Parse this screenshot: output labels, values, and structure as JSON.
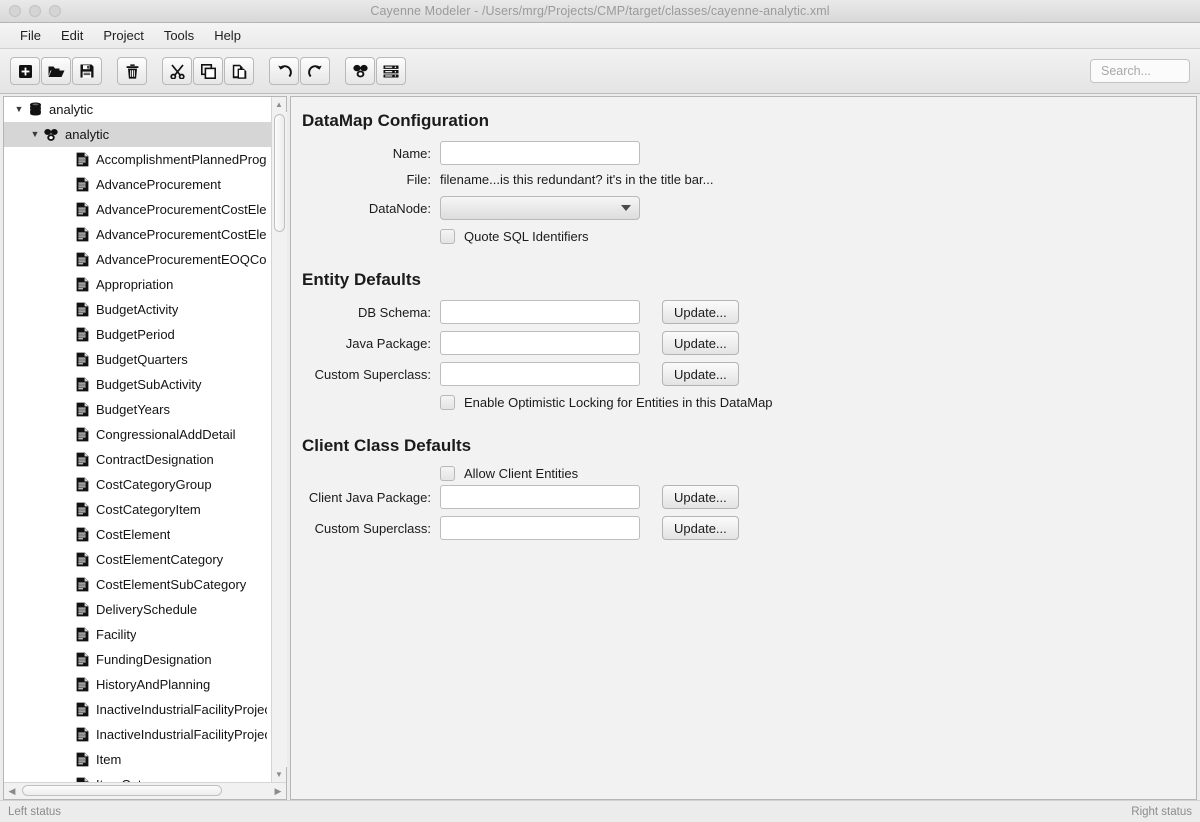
{
  "window": {
    "title": "Cayenne Modeler - /Users/mrg/Projects/CMP/target/classes/cayenne-analytic.xml"
  },
  "menubar": {
    "items": [
      {
        "label": "File"
      },
      {
        "label": "Edit"
      },
      {
        "label": "Project"
      },
      {
        "label": "Tools"
      },
      {
        "label": "Help"
      }
    ]
  },
  "toolbar": {
    "groups": [
      [
        {
          "icon": "new-project-icon",
          "name": "new-button"
        },
        {
          "icon": "open-folder-icon",
          "name": "open-button"
        },
        {
          "icon": "save-floppy-icon",
          "name": "save-button"
        }
      ],
      [
        {
          "icon": "trash-icon",
          "name": "delete-button"
        }
      ],
      [
        {
          "icon": "scissors-icon",
          "name": "cut-button"
        },
        {
          "icon": "copy-icon",
          "name": "copy-button"
        },
        {
          "icon": "paste-icon",
          "name": "paste-button"
        }
      ],
      [
        {
          "icon": "undo-arrow-icon",
          "name": "undo-button"
        },
        {
          "icon": "redo-arrow-icon",
          "name": "redo-button"
        }
      ],
      [
        {
          "icon": "datamap-cubes-icon",
          "name": "create-datamap-button"
        },
        {
          "icon": "datanode-stack-icon",
          "name": "create-datanode-button"
        }
      ]
    ],
    "search_placeholder": "Search...",
    "search_value": ""
  },
  "tree": {
    "nodes": [
      {
        "label": "analytic",
        "level": 0,
        "icon": "database-icon",
        "twisty": "down",
        "selected": false
      },
      {
        "label": "analytic",
        "level": 1,
        "icon": "datamap-icon",
        "twisty": "down",
        "selected": true
      },
      {
        "label": "AccomplishmentPlannedProgram",
        "level": 2,
        "icon": "entity-icon",
        "twisty": "",
        "selected": false
      },
      {
        "label": "AdvanceProcurement",
        "level": 2,
        "icon": "entity-icon",
        "twisty": "",
        "selected": false
      },
      {
        "label": "AdvanceProcurementCostElement",
        "level": 2,
        "icon": "entity-icon",
        "twisty": "",
        "selected": false
      },
      {
        "label": "AdvanceProcurementCostElementDetail",
        "level": 2,
        "icon": "entity-icon",
        "twisty": "",
        "selected": false
      },
      {
        "label": "AdvanceProcurementEOQCost",
        "level": 2,
        "icon": "entity-icon",
        "twisty": "",
        "selected": false
      },
      {
        "label": "Appropriation",
        "level": 2,
        "icon": "entity-icon",
        "twisty": "",
        "selected": false
      },
      {
        "label": "BudgetActivity",
        "level": 2,
        "icon": "entity-icon",
        "twisty": "",
        "selected": false
      },
      {
        "label": "BudgetPeriod",
        "level": 2,
        "icon": "entity-icon",
        "twisty": "",
        "selected": false
      },
      {
        "label": "BudgetQuarters",
        "level": 2,
        "icon": "entity-icon",
        "twisty": "",
        "selected": false
      },
      {
        "label": "BudgetSubActivity",
        "level": 2,
        "icon": "entity-icon",
        "twisty": "",
        "selected": false
      },
      {
        "label": "BudgetYears",
        "level": 2,
        "icon": "entity-icon",
        "twisty": "",
        "selected": false
      },
      {
        "label": "CongressionalAddDetail",
        "level": 2,
        "icon": "entity-icon",
        "twisty": "",
        "selected": false
      },
      {
        "label": "ContractDesignation",
        "level": 2,
        "icon": "entity-icon",
        "twisty": "",
        "selected": false
      },
      {
        "label": "CostCategoryGroup",
        "level": 2,
        "icon": "entity-icon",
        "twisty": "",
        "selected": false
      },
      {
        "label": "CostCategoryItem",
        "level": 2,
        "icon": "entity-icon",
        "twisty": "",
        "selected": false
      },
      {
        "label": "CostElement",
        "level": 2,
        "icon": "entity-icon",
        "twisty": "",
        "selected": false
      },
      {
        "label": "CostElementCategory",
        "level": 2,
        "icon": "entity-icon",
        "twisty": "",
        "selected": false
      },
      {
        "label": "CostElementSubCategory",
        "level": 2,
        "icon": "entity-icon",
        "twisty": "",
        "selected": false
      },
      {
        "label": "DeliverySchedule",
        "level": 2,
        "icon": "entity-icon",
        "twisty": "",
        "selected": false
      },
      {
        "label": "Facility",
        "level": 2,
        "icon": "entity-icon",
        "twisty": "",
        "selected": false
      },
      {
        "label": "FundingDesignation",
        "level": 2,
        "icon": "entity-icon",
        "twisty": "",
        "selected": false
      },
      {
        "label": "HistoryAndPlanning",
        "level": 2,
        "icon": "entity-icon",
        "twisty": "",
        "selected": false
      },
      {
        "label": "InactiveIndustrialFacilityProject",
        "level": 2,
        "icon": "entity-icon",
        "twisty": "",
        "selected": false
      },
      {
        "label": "InactiveIndustrialFacilityProjectDetail",
        "level": 2,
        "icon": "entity-icon",
        "twisty": "",
        "selected": false
      },
      {
        "label": "Item",
        "level": 2,
        "icon": "entity-icon",
        "twisty": "",
        "selected": false
      },
      {
        "label": "ItemCategory",
        "level": 2,
        "icon": "entity-icon",
        "twisty": "",
        "selected": false
      }
    ]
  },
  "detail": {
    "datamap": {
      "title": "DataMap Configuration",
      "name_label": "Name:",
      "name_value": "",
      "file_label": "File:",
      "file_value": "filename...is this redundant?  it's in the title bar...",
      "datanode_label": "DataNode:",
      "datanode_value": "",
      "quote_sql_label": "Quote SQL Identifiers",
      "quote_sql_checked": false
    },
    "entity_defaults": {
      "title": "Entity Defaults",
      "rows": [
        {
          "label": "DB Schema:",
          "value": "",
          "button": "Update..."
        },
        {
          "label": "Java Package:",
          "value": "",
          "button": "Update..."
        },
        {
          "label": "Custom Superclass:",
          "value": "",
          "button": "Update..."
        }
      ],
      "optimistic_locking_label": "Enable Optimistic Locking for Entities in this DataMap",
      "optimistic_locking_checked": false
    },
    "client_class_defaults": {
      "title": "Client Class Defaults",
      "allow_client_label": "Allow Client Entities",
      "allow_client_checked": false,
      "rows": [
        {
          "label": "Client Java Package:",
          "value": "",
          "button": "Update..."
        },
        {
          "label": "Custom Superclass:",
          "value": "",
          "button": "Update..."
        }
      ]
    }
  },
  "statusbar": {
    "left": "Left status",
    "right": "Right status"
  }
}
